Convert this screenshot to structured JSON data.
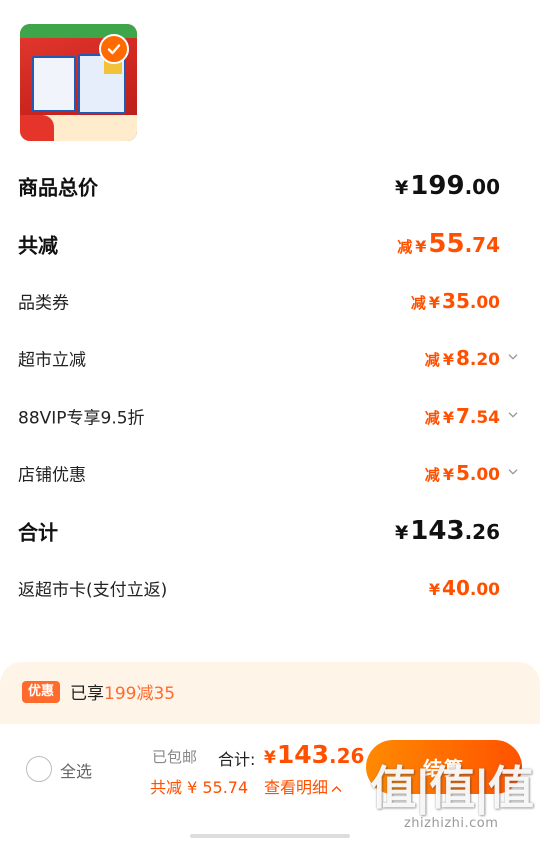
{
  "product": {
    "image": "product-thumbnail",
    "checked_icon": "checkmark-icon"
  },
  "price_rows": [
    {
      "label": "商品总价",
      "prefix": "",
      "yen": "¥",
      "int": "199",
      "dec": ".00",
      "has_chevron": false
    },
    {
      "label": "共减",
      "prefix": "减",
      "yen": "¥",
      "int": "55",
      "dec": ".74",
      "has_chevron": false
    },
    {
      "label": "品类券",
      "prefix": "减",
      "yen": "¥",
      "int": "35",
      "dec": ".00",
      "has_chevron": false
    },
    {
      "label": "超市立减",
      "prefix": "减",
      "yen": "¥",
      "int": "8",
      "dec": ".20",
      "has_chevron": true
    },
    {
      "label": "88VIP专享9.5折",
      "prefix": "减",
      "yen": "¥",
      "int": "7",
      "dec": ".54",
      "has_chevron": true
    },
    {
      "label": "店铺优惠",
      "prefix": "减",
      "yen": "¥",
      "int": "5",
      "dec": ".00",
      "has_chevron": true
    },
    {
      "label": "合计",
      "prefix": "",
      "yen": "¥",
      "int": "143",
      "dec": ".26",
      "has_chevron": false
    },
    {
      "label": "返超市卡(支付立返)",
      "prefix": "",
      "yen": "¥",
      "int": "40",
      "dec": ".00",
      "has_chevron": false
    }
  ],
  "promo": {
    "tag": "优惠",
    "text_prefix": "已享",
    "text_highlight": "199减35"
  },
  "bottom_bar": {
    "select_all": "全选",
    "shipping": "已包邮",
    "total_label": "合计:",
    "total_yen": "¥",
    "total_int": "143",
    "total_dec": ".26",
    "savings": "共减 ¥ 55.74",
    "detail_link": "查看明细",
    "checkout": "结算"
  },
  "watermark": {
    "big": "值|值|值",
    "small": "zhizhizhi.com"
  },
  "colors": {
    "accent_orange": "#ff5000",
    "promo_bg": "#fff4e8",
    "checkout_from": "#ff8a00",
    "checkout_to": "#ff5200"
  }
}
